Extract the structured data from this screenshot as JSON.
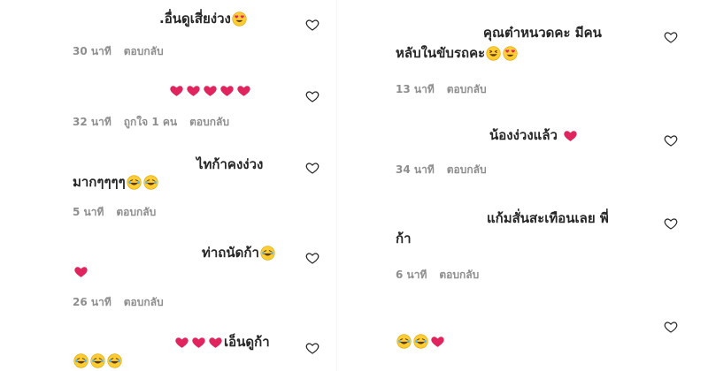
{
  "left": [
    {
      "text_html_parts": [
        ".อื่นดูเสี่ยง่วง"
      ],
      "emojis_after": [
        "heart-eyes"
      ],
      "time": "30 นาที",
      "likes": "",
      "reply": "ตอบกลับ"
    },
    {
      "text_html_parts": [
        ""
      ],
      "emojis_after": [
        "heart",
        "heart",
        "heart",
        "heart",
        "heart"
      ],
      "time": "32 นาที",
      "likes": "ถูกใจ 1 คน",
      "reply": "ตอบกลับ"
    },
    {
      "line1": "ไทก้าคงง่วง",
      "line2": "มากๆๆๆๆ",
      "emojis_line2": [
        "laugh",
        "laugh"
      ],
      "time": "5 นาที",
      "likes": "",
      "reply": "ตอบกลับ"
    },
    {
      "line1": "ท่าถนัดก้า",
      "emojis_line1": [
        "laugh"
      ],
      "emojis_line2": [
        "heart"
      ],
      "time": "26 นาที",
      "likes": "",
      "reply": "ตอบกลับ"
    },
    {
      "line1": "เอ็นดูก้า",
      "emojis_before_line1": [
        "heart",
        "heart",
        "heart"
      ],
      "emojis_line2": [
        "laugh",
        "laugh",
        "laugh"
      ]
    }
  ],
  "right": [
    {
      "line1": "คุณต๋าหนวดคะ มีคน",
      "line2": "หลับในขับรถคะ",
      "emojis_line2": [
        "squint-laugh",
        "heart-eyes"
      ],
      "time": "13 นาที",
      "reply": "ตอบกลับ"
    },
    {
      "line1": "น้องง่วงแล้ว",
      "emojis_line1": [
        "heart"
      ],
      "time": "34 นาที",
      "reply": "ตอบกลับ"
    },
    {
      "line1": "แก้มสั่นสะเทือนเลย พี่",
      "line2": "ก้า",
      "time": "6 นาที",
      "reply": "ตอบกลับ"
    },
    {
      "emojis_line1": [
        "laugh",
        "laugh",
        "heart"
      ]
    }
  ],
  "colors": {
    "text": "#262626",
    "meta": "#8e8e8e",
    "heart": "#e0245e",
    "emoji_face": "#ffcc33"
  }
}
